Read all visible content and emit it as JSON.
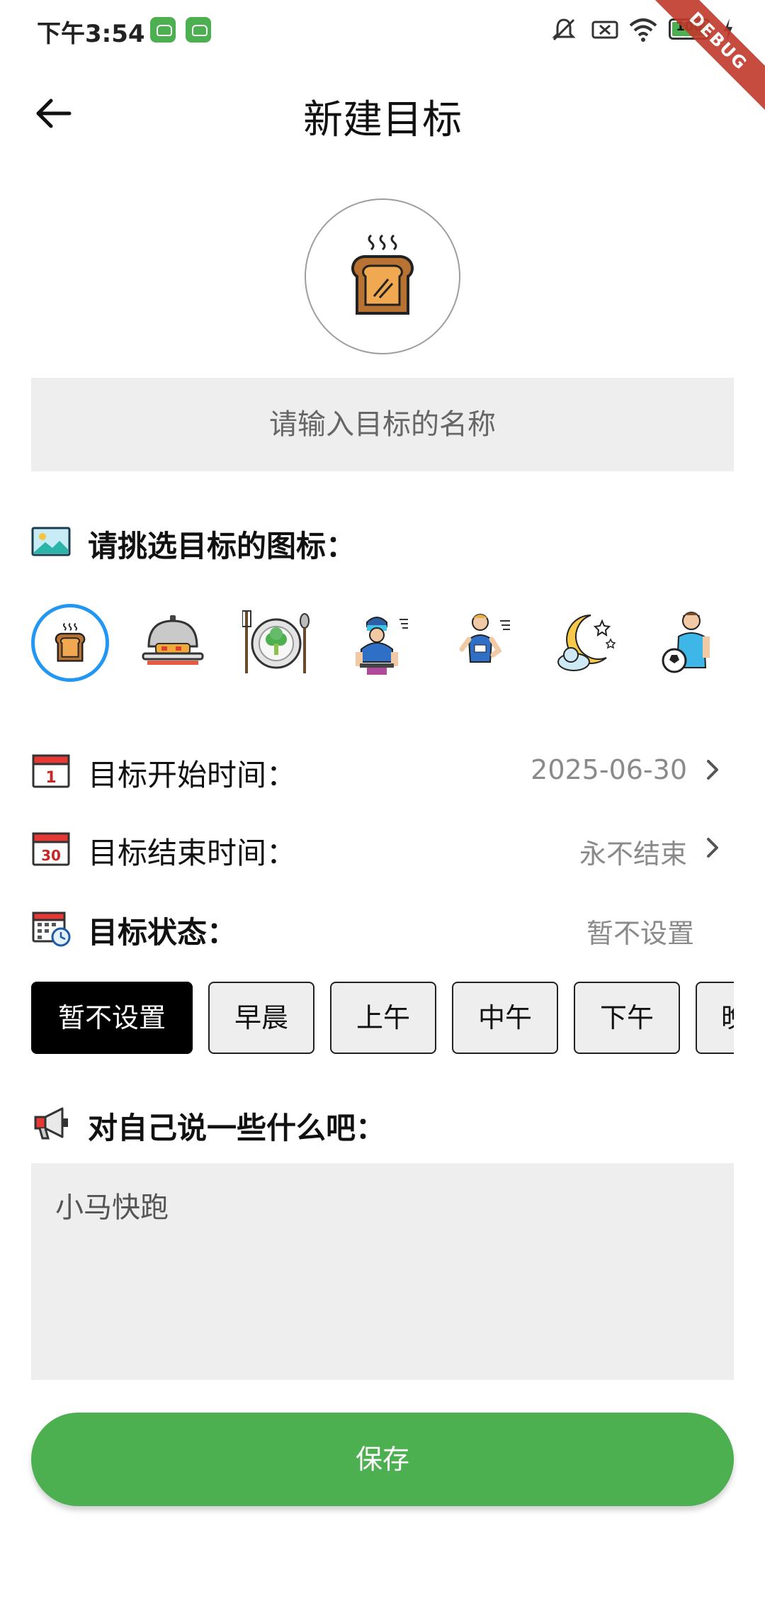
{
  "status_bar": {
    "time": "下午3:54",
    "battery": "100",
    "debug_banner": "DEBUG"
  },
  "app_bar": {
    "title": "新建目标",
    "back_icon": "arrow-left-icon"
  },
  "selected_icon": "toast-icon",
  "name_input": {
    "value": "",
    "placeholder": "请输入目标的名称"
  },
  "icon_section": {
    "heading": "请挑选目标的图标：",
    "heading_icon": "landscape-picture-icon",
    "icons": [
      {
        "name": "toast-icon",
        "selected": true
      },
      {
        "name": "cloche-dish-icon",
        "selected": false
      },
      {
        "name": "broccoli-plate-icon",
        "selected": false
      },
      {
        "name": "cyclist-icon",
        "selected": false
      },
      {
        "name": "runner-icon",
        "selected": false
      },
      {
        "name": "moon-cloud-icon",
        "selected": false
      },
      {
        "name": "soccer-player-icon",
        "selected": false
      }
    ]
  },
  "start_time": {
    "label": "目标开始时间：",
    "value": "2025-06-30",
    "icon": "calendar-1-icon"
  },
  "end_time": {
    "label": "目标结束时间：",
    "value": "永不结束",
    "icon": "calendar-30-icon"
  },
  "status": {
    "label": "目标状态：",
    "value": "暂不设置",
    "icon": "calendar-clock-icon"
  },
  "time_chips": [
    "暂不设置",
    "早晨",
    "上午",
    "中午",
    "下午",
    "晚上"
  ],
  "time_chip_selected": 0,
  "note_section": {
    "heading": "对自己说一些什么吧：",
    "icon": "megaphone-icon",
    "value": "小马快跑"
  },
  "save_button": "保存",
  "colors": {
    "accent": "#4CAF50",
    "selection": "#2196F3",
    "field_bg": "#eeeeee"
  }
}
